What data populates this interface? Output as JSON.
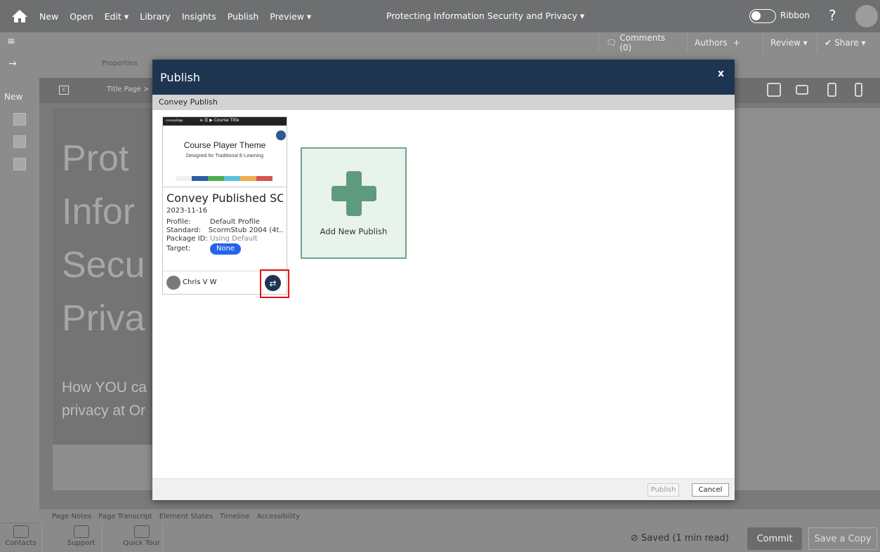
{
  "topbar": {
    "menu": [
      "New",
      "Open",
      "Edit ▾",
      "Library",
      "Insights",
      "Publish",
      "Preview ▾"
    ],
    "doc_title": "Protecting Information Security and Privacy ▾",
    "ribbon_label": "Ribbon",
    "help": "?"
  },
  "bar2": {
    "comments": "Comments (0)",
    "authors": "Authors",
    "authors_add": "+",
    "review": "Review ▾",
    "share": "Share ▾"
  },
  "toolbar": {
    "properties": "Properties"
  },
  "leftrail": {
    "new_label": "New"
  },
  "crumbs": {
    "item": "c",
    "title_page": "Title Page >"
  },
  "canvas": {
    "big_lines": [
      "Prot",
      "Infor",
      "Secu",
      "Priva"
    ],
    "sub_lines": [
      "How YOU ca",
      "privacy at Or"
    ]
  },
  "notes_tabs": [
    "Page Notes",
    "Page Transcript",
    "Element States",
    "Timeline",
    "Accessibility"
  ],
  "bottom": {
    "items": [
      "Contacts",
      "Support",
      "Quick Tour"
    ],
    "saved": "Saved (1 min read)",
    "commit": "Commit",
    "save_copy": "Save a Copy"
  },
  "modal": {
    "title": "Publish",
    "close": "x",
    "section": "Convey Publish",
    "card": {
      "thumb_brand": "conveyEdge",
      "thumb_controls": "≡  ☰  ▶  Course Title",
      "thumb_title": "Course Player Theme",
      "thumb_subtitle": "Designed for Traditional E-Learning",
      "name": "Convey Published SC...",
      "date": "2023-11-16",
      "profile_k": "Profile:",
      "profile_v": "Default Profile",
      "standard_k": "Standard:",
      "standard_v": "ScormStub 2004 (4t...",
      "package_k": "Package ID:",
      "package_v": "Using Default",
      "target_k": "Target:",
      "target_v": "None",
      "user": "Chris V W",
      "swap_icon": "⇄"
    },
    "add_new": "Add New Publish",
    "publish_btn": "Publish",
    "cancel_btn": "Cancel"
  },
  "colors": {
    "header": "#1e3551",
    "accent_green": "#5f9a7e",
    "pill_blue": "#2563eb",
    "swatches": [
      "#f0f0f0",
      "#2b5fa6",
      "#4caf50",
      "#5bc0de",
      "#f0ad4e",
      "#d9534f"
    ]
  }
}
